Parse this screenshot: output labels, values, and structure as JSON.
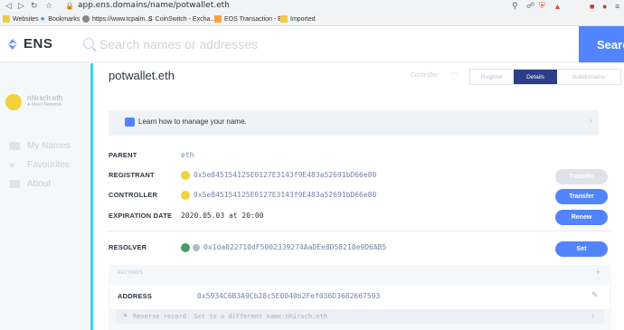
{
  "browser": {
    "url": "app.ens.domains/name/potwallet.eth",
    "bookmarks": [
      {
        "label": "Websites",
        "color": "#f5c842"
      },
      {
        "label": "Bookmarks",
        "color": "#3b78e7"
      },
      {
        "label": "https://www.tcpalm....",
        "color": "#888888"
      },
      {
        "label": "CoinSwitch - Excha...",
        "color": "#222222"
      },
      {
        "label": "EOS Transaction - E...",
        "color": "#f4a340"
      },
      {
        "label": "Imported",
        "color": "#f5c842"
      }
    ]
  },
  "header": {
    "logo_text": "ENS",
    "search_placeholder": "Search names or addresses",
    "search_button": "Search"
  },
  "sidebar": {
    "user": "nhirsch.eth",
    "network": "Main Network",
    "items": [
      {
        "label": "My Names",
        "icon": "names-icon"
      },
      {
        "label": "Favourites",
        "icon": "heart-icon"
      },
      {
        "label": "About",
        "icon": "about-icon"
      }
    ]
  },
  "name": {
    "title": "potwallet.eth",
    "controller_label": "Controller",
    "tabs": [
      {
        "label": "Register",
        "active": false
      },
      {
        "label": "Details",
        "active": true
      },
      {
        "label": "Subdomains",
        "active": false
      }
    ]
  },
  "learn": {
    "text": "Learn how to manage your name."
  },
  "details": {
    "parent": {
      "label": "PARENT",
      "value": "eth"
    },
    "registrant": {
      "label": "REGISTRANT",
      "value": "0x5e845154125E0127E3143f9E483a52691bD66e80",
      "button": "Transfer"
    },
    "controller": {
      "label": "CONTROLLER",
      "value": "0x5e845154125E0127E3143f9E483a52691bD66e80",
      "button": "Transfer"
    },
    "expiration": {
      "label": "EXPIRATION DATE",
      "value": "2020.05.03 at 20:00",
      "button": "Renew"
    },
    "resolver": {
      "label": "RESOLVER",
      "value": "0x1da022710dF5002339274AaDEe8D58218e9D6AB5",
      "button": "Set"
    }
  },
  "records": {
    "label": "RECORDS",
    "plus": "+",
    "address_label": "ADDRESS",
    "address_value": "0x5934C6B3A9Cb28c5E0040b2Fef036D3682667593",
    "reverse_text": "Reverse record: Set to a different name:nhirsch.eth"
  },
  "colors": {
    "primary": "#5284ff",
    "active_tab": "#2d3d86",
    "divider": "#41d6d6"
  }
}
